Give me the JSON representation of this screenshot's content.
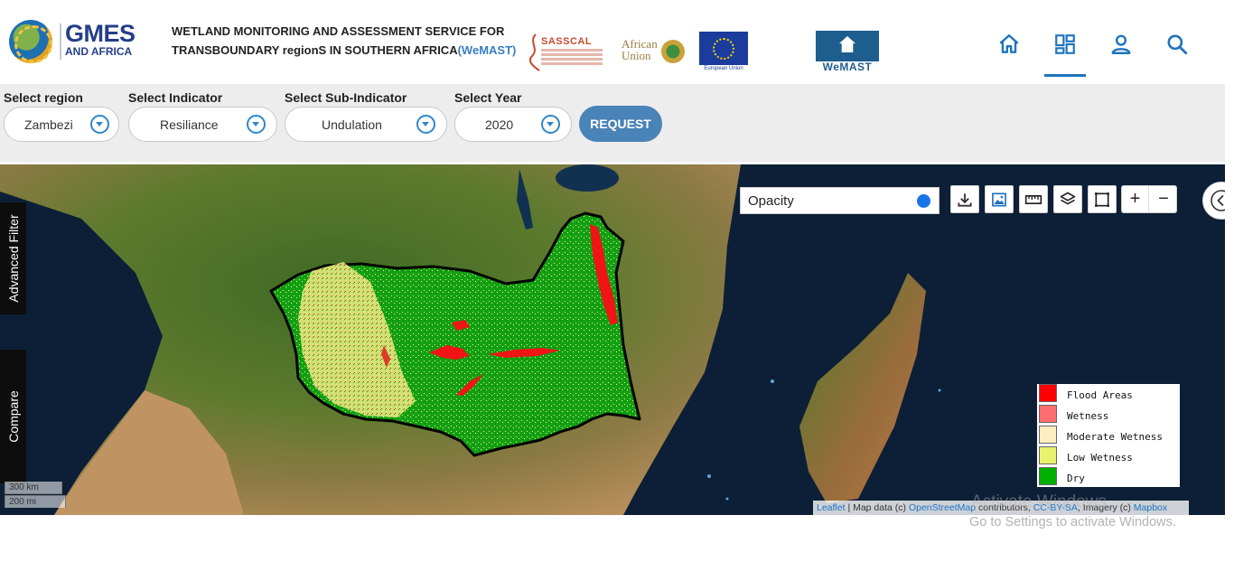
{
  "header": {
    "gmes_logo_line1": "GMES",
    "gmes_logo_line2": "AND AFRICA",
    "title_line1": "WETLAND MONITORING AND ASSESSMENT SERVICE FOR",
    "title_line2": "TRANSBOUNDARY regionS IN SOUTHERN AFRICA",
    "title_acronym": "(WeMAST)",
    "sasscal_logo": "SASSCAL",
    "african_union_logo": "African Union",
    "eu_logo_caption": "European Union",
    "wemast_logo": "WeMAST",
    "nav_icons": [
      "home-icon",
      "dashboard-icon",
      "user-icon",
      "search-icon"
    ],
    "active_nav": "dashboard"
  },
  "filters": {
    "region_label": "Select region",
    "region_value": "Zambezi",
    "indicator_label": "Select Indicator",
    "indicator_value": "Resiliance",
    "subindicator_label": "Select Sub-Indicator",
    "subindicator_value": "Undulation",
    "year_label": "Select Year",
    "year_value": "2020",
    "request_button": "REQUEST"
  },
  "map": {
    "side_tabs": [
      "Advanced Filter",
      "Compare"
    ],
    "opacity_label": "Opacity",
    "opacity_value": 1.0,
    "tool_icons": [
      "download-icon",
      "image-icon",
      "ruler-icon",
      "layers-icon",
      "fullscreen-icon"
    ],
    "zoom_in": "+",
    "zoom_out": "−",
    "legend": [
      {
        "label": "Flood Areas",
        "color": "#ff0000"
      },
      {
        "label": "Wetness",
        "color": "#ff6e6e"
      },
      {
        "label": "Moderate Wetness",
        "color": "#ffeebf"
      },
      {
        "label": "Low Wetness",
        "color": "#e7f36a"
      },
      {
        "label": "Dry",
        "color": "#00b000"
      }
    ],
    "scale_km": "300 km",
    "scale_mi": "200 mi",
    "attribution": {
      "leaflet": "Leaflet",
      "text1": " | Map data (c) ",
      "osm": "OpenStreetMap",
      "text2": " contributors, ",
      "license": "CC-BY-SA",
      "text3": ", Imagery (c) ",
      "mapbox": "Mapbox"
    }
  },
  "watermark": {
    "line1": "Activate Windows",
    "line2": "Go to Settings to activate Windows."
  }
}
